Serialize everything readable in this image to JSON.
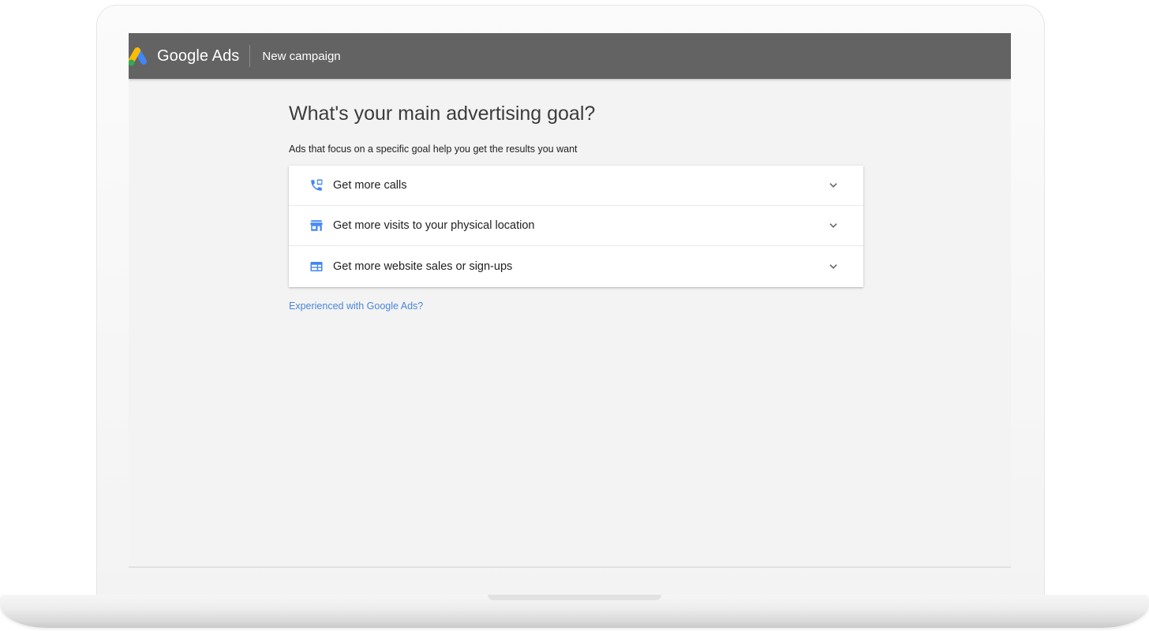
{
  "header": {
    "brand": "Google Ads",
    "page_name": "New campaign"
  },
  "main": {
    "title": "What's your main advertising goal?",
    "subtitle": "Ads that focus on a specific goal help you get the results you want",
    "goals": [
      {
        "label": "Get more calls",
        "icon": "phone-forward-icon"
      },
      {
        "label": "Get more visits to your physical location",
        "icon": "storefront-icon"
      },
      {
        "label": "Get more website sales or sign-ups",
        "icon": "web-page-icon"
      }
    ],
    "experienced_link": "Experienced with Google Ads?"
  },
  "colors": {
    "topbar": "#636363",
    "screen_background": "#f3f3f3",
    "icon_blue": "#4285f4",
    "link_blue": "#4a86d8",
    "logo_yellow": "#fbbc04",
    "logo_blue": "#4285f4",
    "logo_green": "#34a853"
  }
}
